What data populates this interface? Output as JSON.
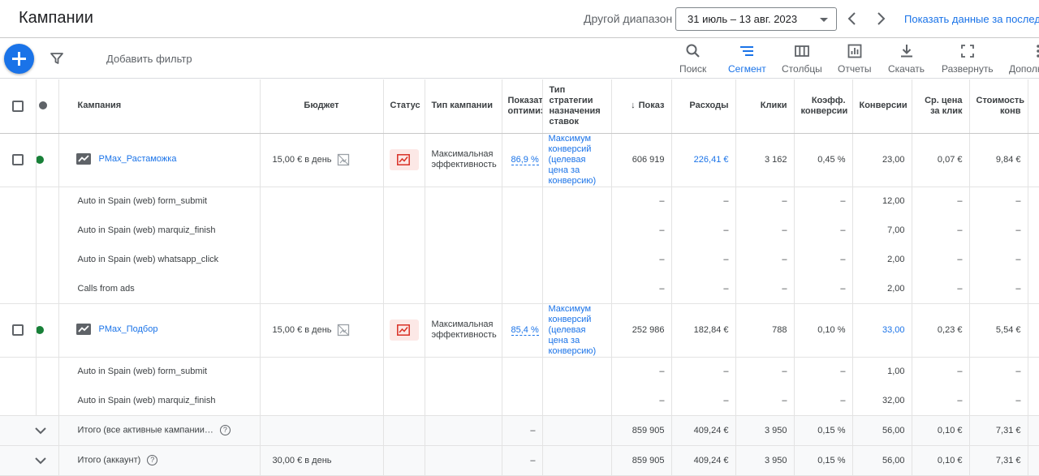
{
  "header": {
    "title": "Кампании",
    "range_label": "Другой диапазон",
    "date_range": "31 июль – 13 авг. 2023",
    "compare_link": "Показать данные за последние"
  },
  "toolbar": {
    "add_filter": "Добавить фильтр",
    "tools": [
      {
        "label": "Поиск",
        "icon": "search-icon"
      },
      {
        "label": "Сегмент",
        "icon": "segment-icon",
        "active": true
      },
      {
        "label": "Столбцы",
        "icon": "columns-icon"
      },
      {
        "label": "Отчеты",
        "icon": "reports-icon"
      },
      {
        "label": "Скачать",
        "icon": "download-icon"
      },
      {
        "label": "Развернуть",
        "icon": "expand-icon"
      },
      {
        "label": "Дополнительно",
        "icon": "more-vert-icon"
      }
    ]
  },
  "columns": {
    "campaign": "Кампания",
    "budget": "Бюджет",
    "status": "Статус",
    "campaign_type": "Тип кампании",
    "optimization": "Показатель оптимизации",
    "bid_strategy": "Тип стратегии назначения ставок",
    "impressions": "Показ",
    "cost": "Расходы",
    "clicks": "Клики",
    "conv_rate": "Коэфф. конверсии",
    "conversions": "Конверсии",
    "avg_cpc": "Ср. цена за клик",
    "cost_conv": "Стоимость конв"
  },
  "campaigns": [
    {
      "name": "PMax_Растаможка",
      "budget": "15,00 € в день",
      "type": "Максимальная эффективность",
      "optimization": "86,9 %",
      "strategy": "Максимум конверсий (целевая цена за конверсию)",
      "impressions": "606 919",
      "cost": "226,41 €",
      "clicks": "3 162",
      "conv_rate": "0,45 %",
      "conversions": "23,00",
      "avg_cpc": "0,07 €",
      "cost_conv": "9,84 €",
      "segments": [
        {
          "name": "Auto in Spain (web) form_submit",
          "conversions": "12,00"
        },
        {
          "name": "Auto in Spain (web) marquiz_finish",
          "conversions": "7,00"
        },
        {
          "name": "Auto in Spain (web) whatsapp_click",
          "conversions": "2,00"
        },
        {
          "name": "Calls from ads",
          "conversions": "2,00"
        }
      ]
    },
    {
      "name": "PMax_Подбор",
      "budget": "15,00 € в день",
      "type": "Максимальная эффективность",
      "optimization": "85,4 %",
      "strategy": "Максимум конверсий (целевая цена за конверсию)",
      "impressions": "252 986",
      "cost": "182,84 €",
      "clicks": "788",
      "conv_rate": "0,10 %",
      "conversions": "33,00",
      "avg_cpc": "0,23 €",
      "cost_conv": "5,54 €",
      "segments": [
        {
          "name": "Auto in Spain (web) form_submit",
          "conversions": "1,00"
        },
        {
          "name": "Auto in Spain (web) marquiz_finish",
          "conversions": "32,00"
        }
      ]
    }
  ],
  "dash": "–",
  "totals": [
    {
      "label": "Итого (все активные кампании…",
      "budget": "",
      "optimization": "–",
      "impressions": "859 905",
      "cost": "409,24 €",
      "clicks": "3 950",
      "conv_rate": "0,15 %",
      "conversions": "56,00",
      "avg_cpc": "0,10 €",
      "cost_conv": "7,31 €"
    },
    {
      "label": "Итого (аккаунт)",
      "budget": "30,00 € в день",
      "optimization": "–",
      "impressions": "859 905",
      "cost": "409,24 €",
      "clicks": "3 950",
      "conv_rate": "0,15 %",
      "conversions": "56,00",
      "avg_cpc": "0,10 €",
      "cost_conv": "7,31 €"
    }
  ],
  "colors": {
    "accent": "#1a73e8",
    "enabled_dot": "#188038",
    "status_red": "#d93025"
  }
}
